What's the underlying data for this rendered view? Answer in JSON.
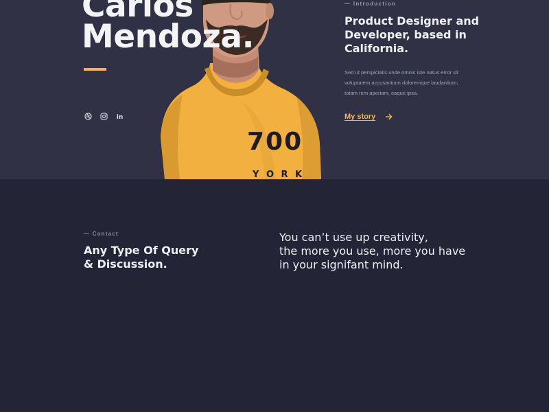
{
  "hero": {
    "name_line1": "Carlos",
    "name_line2": "Mendoza.",
    "accent_color": "#f7b34b",
    "social": [
      {
        "icon": "dribbble-icon"
      },
      {
        "icon": "instagram-icon"
      },
      {
        "icon": "linkedin-icon",
        "glyph": "in"
      }
    ],
    "portrait": {
      "shirt_text_1": "700",
      "shirt_text_2": "Y O R K"
    }
  },
  "intro": {
    "eyebrow": "— Introduction",
    "headline": "Product Designer and Developer, based in California.",
    "body": "Sed ut perspiciatis unde omnis iste natus error sit voluptatem accusantium doloremque laudantium, totam rem aperiam, eaque ipsa.",
    "link_label": "My story",
    "link_arrow_icon": "arrow-right-icon"
  },
  "contact": {
    "eyebrow": "— Contact",
    "heading_line1": "Any Type Of Query",
    "heading_line2": "& Discussion.",
    "quote_line1": "You can’t use up creativity,",
    "quote_line2": "the more you use, more you have",
    "quote_line3": "in your signifant mind."
  },
  "colors": {
    "hero_bg": "#303145",
    "page_bg": "#232536",
    "accent": "#f7b34b",
    "text": "#f0f0f4"
  }
}
